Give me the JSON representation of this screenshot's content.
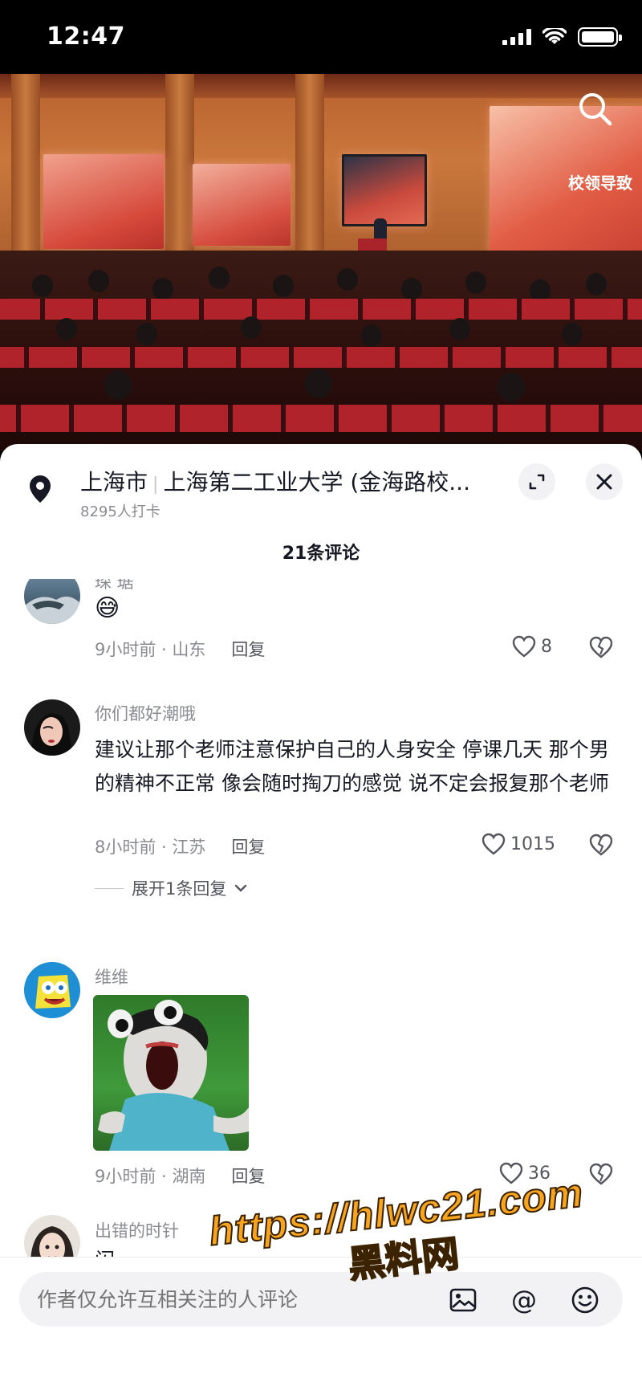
{
  "status_bar": {
    "time": "12:47"
  },
  "video": {
    "right_screen_text": "校领导致"
  },
  "location": {
    "city": "上海市",
    "place": "上海第二工业大学 (金海路校...",
    "checkins": "8295人打卡"
  },
  "comments_header": {
    "title": "21条评论"
  },
  "comments": [
    {
      "user": "琛 琚",
      "text": "😅",
      "meta": "9小时前 · 山东",
      "reply_label": "回复",
      "likes": "8"
    },
    {
      "user": "你们都好潮哦",
      "text": "建议让那个老师注意保护自己的人身安全  停课几天 那个男的精神不正常 像会随时掏刀的感觉 说不定会报复那个老师",
      "meta": "8小时前 · 江苏",
      "reply_label": "回复",
      "likes": "1015",
      "expand_label": "展开1条回复"
    },
    {
      "user": "维维",
      "meta": "9小时前 · 湖南",
      "reply_label": "回复",
      "likes": "36"
    },
    {
      "user": "出错的时针",
      "text": "闪"
    }
  ],
  "input_bar": {
    "placeholder": "作者仅允许互相关注的人评论"
  },
  "watermark": {
    "url": "https://hlwc21.com",
    "name": "黑料网"
  },
  "colors": {
    "accent_like": "#56575e",
    "secondary_text": "#8a8b91",
    "watermark": "#f7a51e"
  }
}
